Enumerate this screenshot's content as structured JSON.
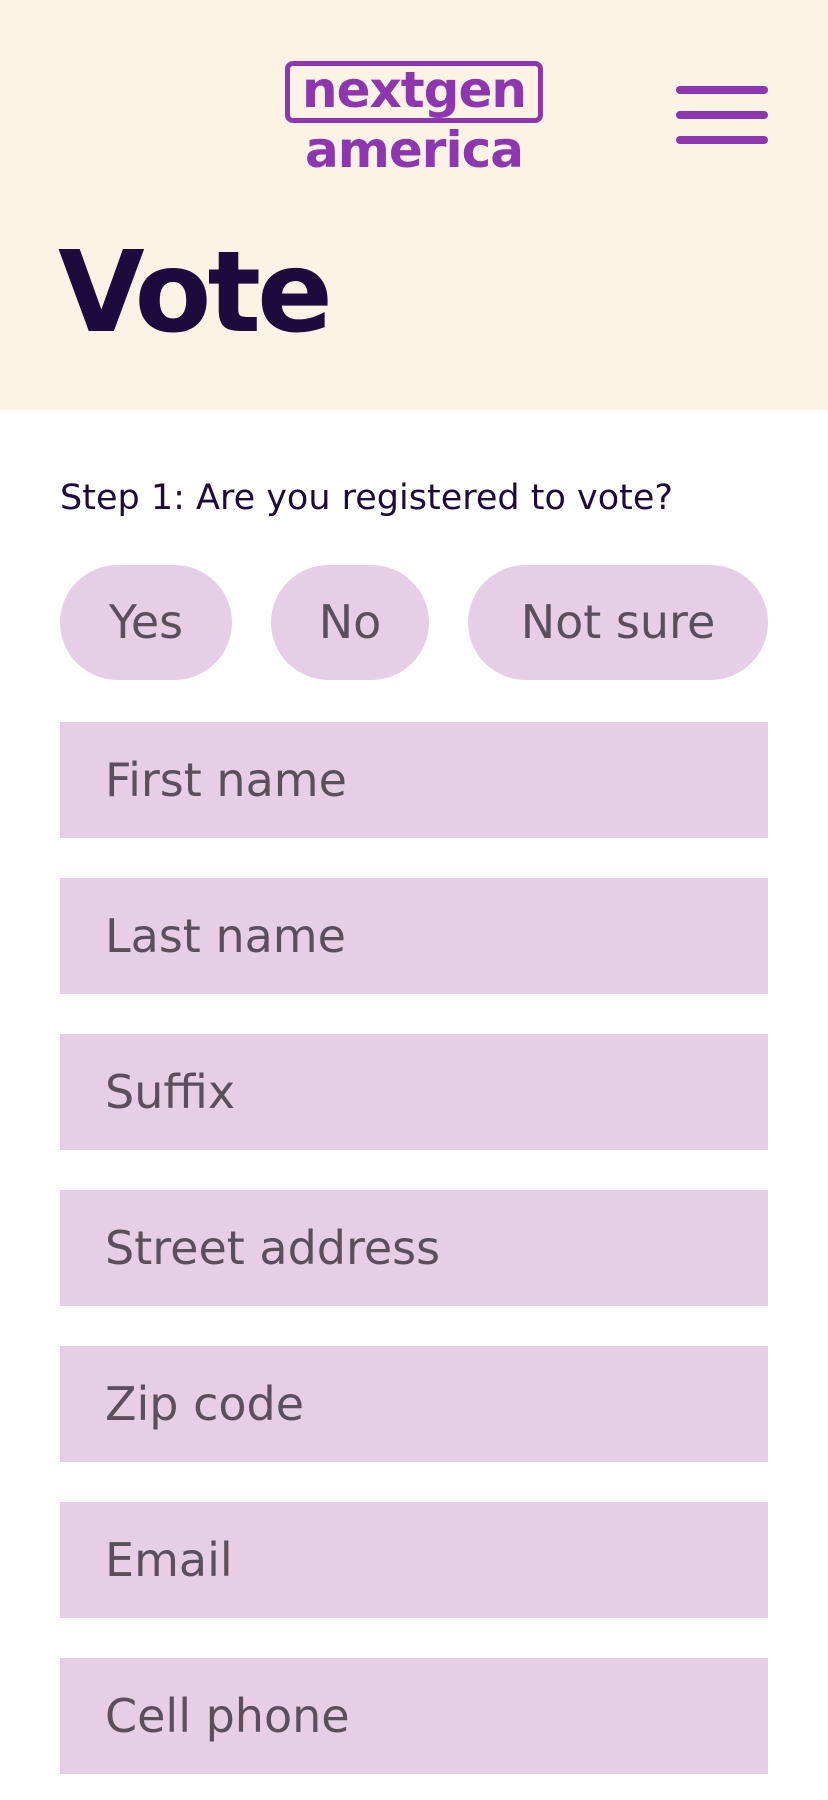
{
  "header": {
    "logo_line1": "nextgen",
    "logo_line2": "america",
    "menu_icon": "hamburger-menu-icon",
    "title": "Vote"
  },
  "form": {
    "question": "Step 1: Are you registered to vote?",
    "choices": [
      "Yes",
      "No",
      "Not sure"
    ],
    "fields": {
      "first_name": "First name",
      "last_name": "Last name",
      "suffix": "Suffix",
      "street_address": "Street address",
      "zip_code": "Zip code",
      "email": "Email",
      "cell_phone": "Cell phone"
    }
  },
  "colors": {
    "header_bg": "#fdf3e4",
    "brand_purple": "#8e36b0",
    "title_text": "#1e0a3c",
    "field_bg": "#e6cfe6",
    "field_text": "#5b4f5d"
  }
}
